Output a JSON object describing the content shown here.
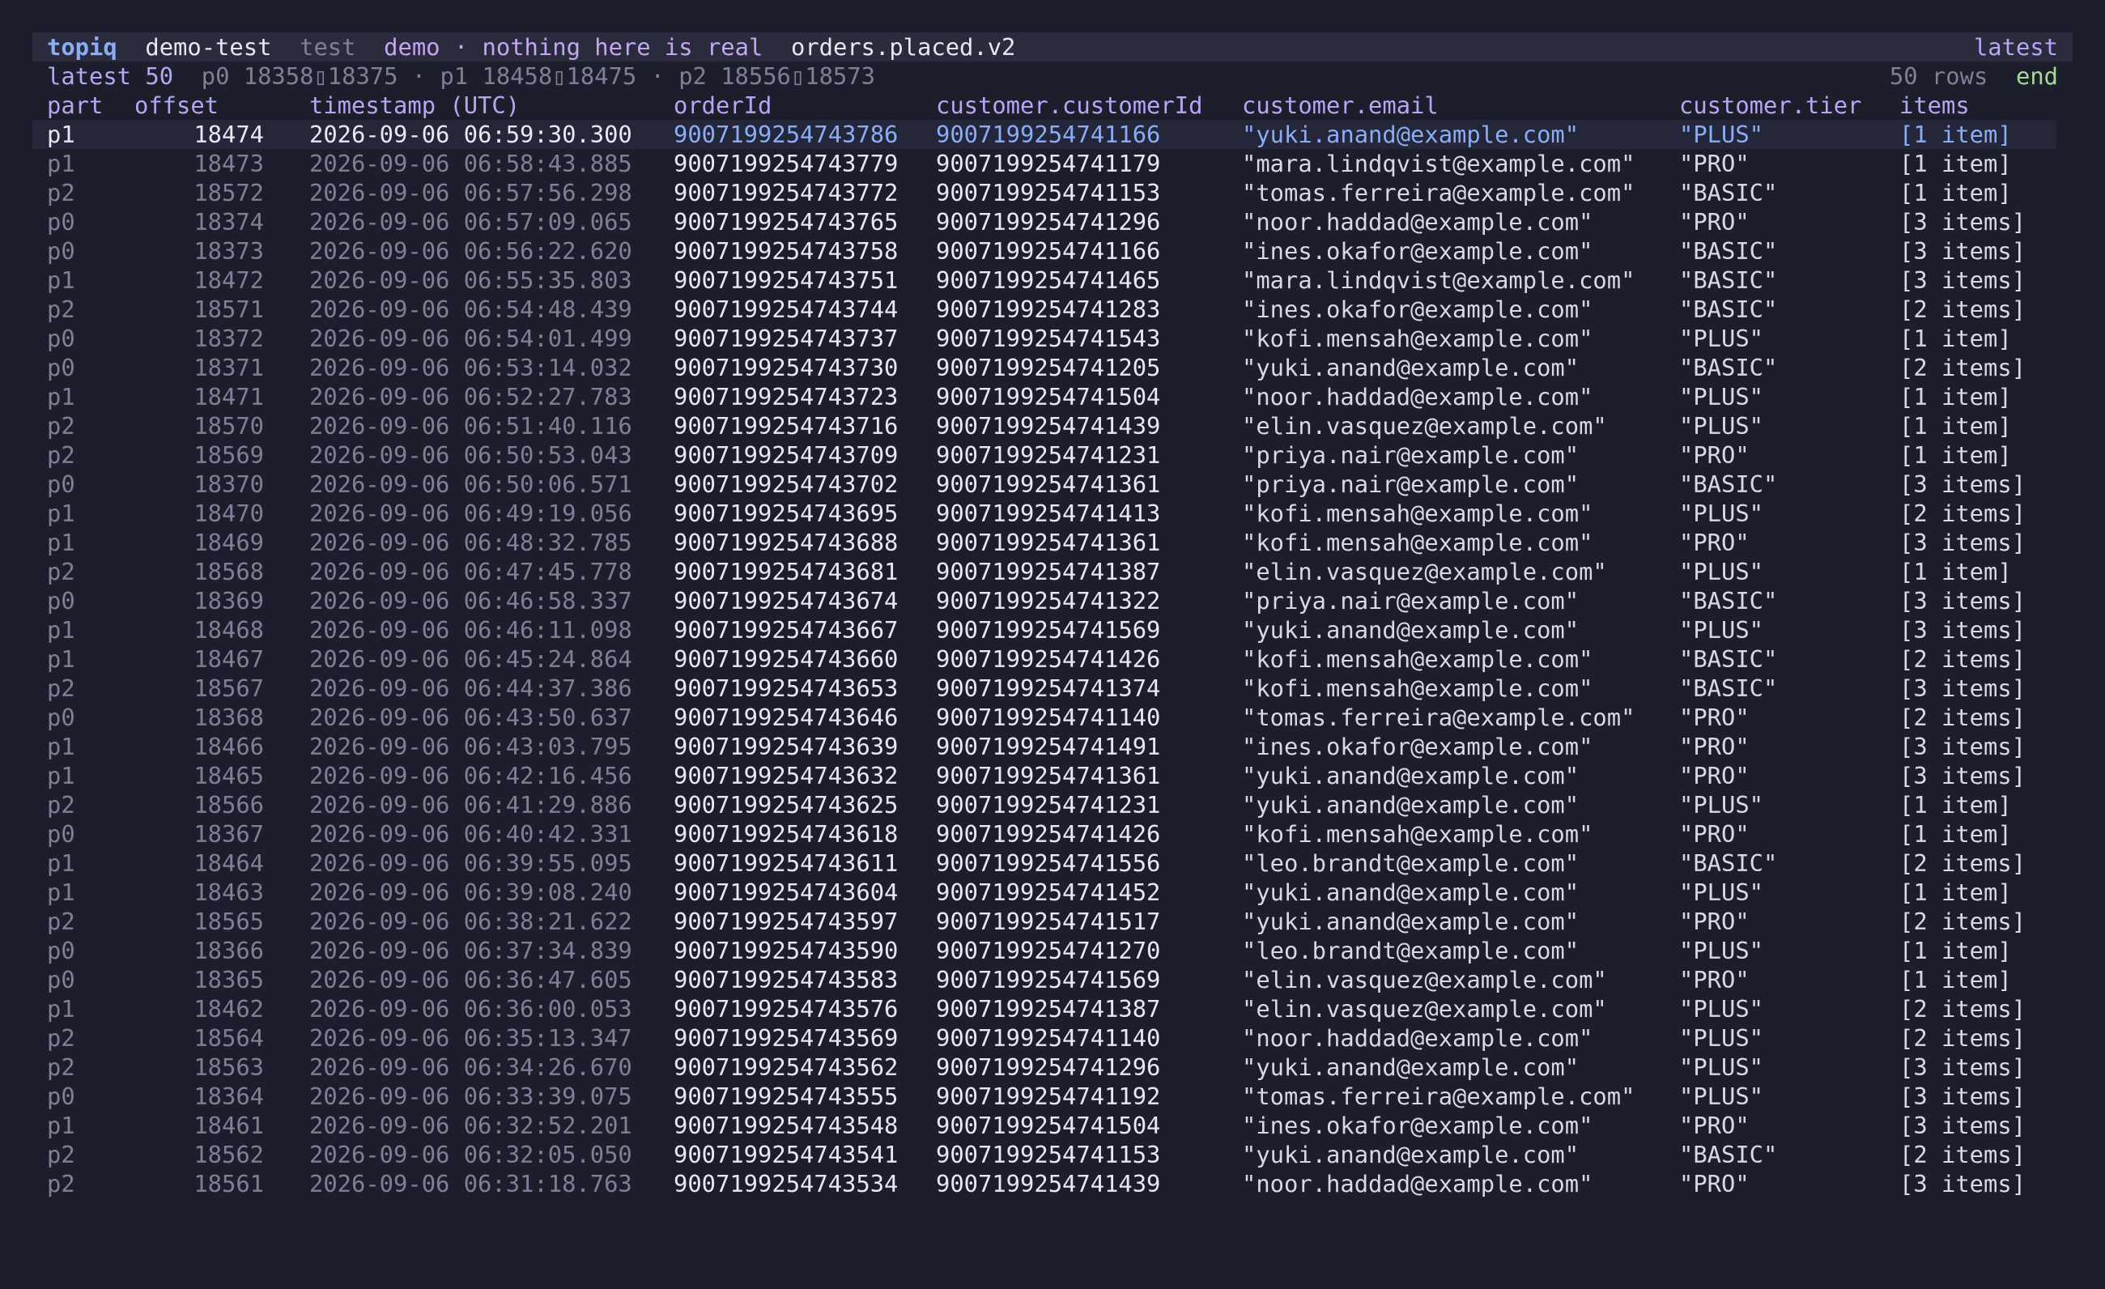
{
  "titlebar": {
    "app": "topiq",
    "profile": "demo-test",
    "env": "test",
    "cluster": "demo",
    "separator": "·",
    "note": "nothing here is real",
    "topic": "orders.placed.v2",
    "mode": "latest"
  },
  "statusbar": {
    "mode": "latest 50",
    "ranges": "p0 18358▯18375 · p1 18458▯18475 · p2 18556▯18573",
    "row_count": "50 rows",
    "position": "end"
  },
  "columns": [
    "part",
    "offset",
    "timestamp (UTC)",
    "orderId",
    "customer.customerId",
    "customer.email",
    "customer.tier",
    "items"
  ],
  "rows": [
    {
      "part": "p1",
      "offset": "18474",
      "ts": "2026-09-06 06:59:30.300",
      "orderId": "9007199254743786",
      "customerId": "9007199254741166",
      "email": "\"yuki.anand@example.com\"",
      "tier": "\"PLUS\"",
      "items": "[1 item]"
    },
    {
      "part": "p1",
      "offset": "18473",
      "ts": "2026-09-06 06:58:43.885",
      "orderId": "9007199254743779",
      "customerId": "9007199254741179",
      "email": "\"mara.lindqvist@example.com\"",
      "tier": "\"PRO\"",
      "items": "[1 item]"
    },
    {
      "part": "p2",
      "offset": "18572",
      "ts": "2026-09-06 06:57:56.298",
      "orderId": "9007199254743772",
      "customerId": "9007199254741153",
      "email": "\"tomas.ferreira@example.com\"",
      "tier": "\"BASIC\"",
      "items": "[1 item]"
    },
    {
      "part": "p0",
      "offset": "18374",
      "ts": "2026-09-06 06:57:09.065",
      "orderId": "9007199254743765",
      "customerId": "9007199254741296",
      "email": "\"noor.haddad@example.com\"",
      "tier": "\"PRO\"",
      "items": "[3 items]"
    },
    {
      "part": "p0",
      "offset": "18373",
      "ts": "2026-09-06 06:56:22.620",
      "orderId": "9007199254743758",
      "customerId": "9007199254741166",
      "email": "\"ines.okafor@example.com\"",
      "tier": "\"BASIC\"",
      "items": "[3 items]"
    },
    {
      "part": "p1",
      "offset": "18472",
      "ts": "2026-09-06 06:55:35.803",
      "orderId": "9007199254743751",
      "customerId": "9007199254741465",
      "email": "\"mara.lindqvist@example.com\"",
      "tier": "\"BASIC\"",
      "items": "[3 items]"
    },
    {
      "part": "p2",
      "offset": "18571",
      "ts": "2026-09-06 06:54:48.439",
      "orderId": "9007199254743744",
      "customerId": "9007199254741283",
      "email": "\"ines.okafor@example.com\"",
      "tier": "\"BASIC\"",
      "items": "[2 items]"
    },
    {
      "part": "p0",
      "offset": "18372",
      "ts": "2026-09-06 06:54:01.499",
      "orderId": "9007199254743737",
      "customerId": "9007199254741543",
      "email": "\"kofi.mensah@example.com\"",
      "tier": "\"PLUS\"",
      "items": "[1 item]"
    },
    {
      "part": "p0",
      "offset": "18371",
      "ts": "2026-09-06 06:53:14.032",
      "orderId": "9007199254743730",
      "customerId": "9007199254741205",
      "email": "\"yuki.anand@example.com\"",
      "tier": "\"BASIC\"",
      "items": "[2 items]"
    },
    {
      "part": "p1",
      "offset": "18471",
      "ts": "2026-09-06 06:52:27.783",
      "orderId": "9007199254743723",
      "customerId": "9007199254741504",
      "email": "\"noor.haddad@example.com\"",
      "tier": "\"PLUS\"",
      "items": "[1 item]"
    },
    {
      "part": "p2",
      "offset": "18570",
      "ts": "2026-09-06 06:51:40.116",
      "orderId": "9007199254743716",
      "customerId": "9007199254741439",
      "email": "\"elin.vasquez@example.com\"",
      "tier": "\"PLUS\"",
      "items": "[1 item]"
    },
    {
      "part": "p2",
      "offset": "18569",
      "ts": "2026-09-06 06:50:53.043",
      "orderId": "9007199254743709",
      "customerId": "9007199254741231",
      "email": "\"priya.nair@example.com\"",
      "tier": "\"PRO\"",
      "items": "[1 item]"
    },
    {
      "part": "p0",
      "offset": "18370",
      "ts": "2026-09-06 06:50:06.571",
      "orderId": "9007199254743702",
      "customerId": "9007199254741361",
      "email": "\"priya.nair@example.com\"",
      "tier": "\"BASIC\"",
      "items": "[3 items]"
    },
    {
      "part": "p1",
      "offset": "18470",
      "ts": "2026-09-06 06:49:19.056",
      "orderId": "9007199254743695",
      "customerId": "9007199254741413",
      "email": "\"kofi.mensah@example.com\"",
      "tier": "\"PLUS\"",
      "items": "[2 items]"
    },
    {
      "part": "p1",
      "offset": "18469",
      "ts": "2026-09-06 06:48:32.785",
      "orderId": "9007199254743688",
      "customerId": "9007199254741361",
      "email": "\"kofi.mensah@example.com\"",
      "tier": "\"PRO\"",
      "items": "[3 items]"
    },
    {
      "part": "p2",
      "offset": "18568",
      "ts": "2026-09-06 06:47:45.778",
      "orderId": "9007199254743681",
      "customerId": "9007199254741387",
      "email": "\"elin.vasquez@example.com\"",
      "tier": "\"PLUS\"",
      "items": "[1 item]"
    },
    {
      "part": "p0",
      "offset": "18369",
      "ts": "2026-09-06 06:46:58.337",
      "orderId": "9007199254743674",
      "customerId": "9007199254741322",
      "email": "\"priya.nair@example.com\"",
      "tier": "\"BASIC\"",
      "items": "[3 items]"
    },
    {
      "part": "p1",
      "offset": "18468",
      "ts": "2026-09-06 06:46:11.098",
      "orderId": "9007199254743667",
      "customerId": "9007199254741569",
      "email": "\"yuki.anand@example.com\"",
      "tier": "\"PLUS\"",
      "items": "[3 items]"
    },
    {
      "part": "p1",
      "offset": "18467",
      "ts": "2026-09-06 06:45:24.864",
      "orderId": "9007199254743660",
      "customerId": "9007199254741426",
      "email": "\"kofi.mensah@example.com\"",
      "tier": "\"BASIC\"",
      "items": "[2 items]"
    },
    {
      "part": "p2",
      "offset": "18567",
      "ts": "2026-09-06 06:44:37.386",
      "orderId": "9007199254743653",
      "customerId": "9007199254741374",
      "email": "\"kofi.mensah@example.com\"",
      "tier": "\"BASIC\"",
      "items": "[3 items]"
    },
    {
      "part": "p0",
      "offset": "18368",
      "ts": "2026-09-06 06:43:50.637",
      "orderId": "9007199254743646",
      "customerId": "9007199254741140",
      "email": "\"tomas.ferreira@example.com\"",
      "tier": "\"PRO\"",
      "items": "[2 items]"
    },
    {
      "part": "p1",
      "offset": "18466",
      "ts": "2026-09-06 06:43:03.795",
      "orderId": "9007199254743639",
      "customerId": "9007199254741491",
      "email": "\"ines.okafor@example.com\"",
      "tier": "\"PRO\"",
      "items": "[3 items]"
    },
    {
      "part": "p1",
      "offset": "18465",
      "ts": "2026-09-06 06:42:16.456",
      "orderId": "9007199254743632",
      "customerId": "9007199254741361",
      "email": "\"yuki.anand@example.com\"",
      "tier": "\"PRO\"",
      "items": "[3 items]"
    },
    {
      "part": "p2",
      "offset": "18566",
      "ts": "2026-09-06 06:41:29.886",
      "orderId": "9007199254743625",
      "customerId": "9007199254741231",
      "email": "\"yuki.anand@example.com\"",
      "tier": "\"PLUS\"",
      "items": "[1 item]"
    },
    {
      "part": "p0",
      "offset": "18367",
      "ts": "2026-09-06 06:40:42.331",
      "orderId": "9007199254743618",
      "customerId": "9007199254741426",
      "email": "\"kofi.mensah@example.com\"",
      "tier": "\"PRO\"",
      "items": "[1 item]"
    },
    {
      "part": "p1",
      "offset": "18464",
      "ts": "2026-09-06 06:39:55.095",
      "orderId": "9007199254743611",
      "customerId": "9007199254741556",
      "email": "\"leo.brandt@example.com\"",
      "tier": "\"BASIC\"",
      "items": "[2 items]"
    },
    {
      "part": "p1",
      "offset": "18463",
      "ts": "2026-09-06 06:39:08.240",
      "orderId": "9007199254743604",
      "customerId": "9007199254741452",
      "email": "\"yuki.anand@example.com\"",
      "tier": "\"PLUS\"",
      "items": "[1 item]"
    },
    {
      "part": "p2",
      "offset": "18565",
      "ts": "2026-09-06 06:38:21.622",
      "orderId": "9007199254743597",
      "customerId": "9007199254741517",
      "email": "\"yuki.anand@example.com\"",
      "tier": "\"PRO\"",
      "items": "[2 items]"
    },
    {
      "part": "p0",
      "offset": "18366",
      "ts": "2026-09-06 06:37:34.839",
      "orderId": "9007199254743590",
      "customerId": "9007199254741270",
      "email": "\"leo.brandt@example.com\"",
      "tier": "\"PLUS\"",
      "items": "[1 item]"
    },
    {
      "part": "p0",
      "offset": "18365",
      "ts": "2026-09-06 06:36:47.605",
      "orderId": "9007199254743583",
      "customerId": "9007199254741569",
      "email": "\"elin.vasquez@example.com\"",
      "tier": "\"PRO\"",
      "items": "[1 item]"
    },
    {
      "part": "p1",
      "offset": "18462",
      "ts": "2026-09-06 06:36:00.053",
      "orderId": "9007199254743576",
      "customerId": "9007199254741387",
      "email": "\"elin.vasquez@example.com\"",
      "tier": "\"PLUS\"",
      "items": "[2 items]"
    },
    {
      "part": "p2",
      "offset": "18564",
      "ts": "2026-09-06 06:35:13.347",
      "orderId": "9007199254743569",
      "customerId": "9007199254741140",
      "email": "\"noor.haddad@example.com\"",
      "tier": "\"PLUS\"",
      "items": "[2 items]"
    },
    {
      "part": "p2",
      "offset": "18563",
      "ts": "2026-09-06 06:34:26.670",
      "orderId": "9007199254743562",
      "customerId": "9007199254741296",
      "email": "\"yuki.anand@example.com\"",
      "tier": "\"PLUS\"",
      "items": "[3 items]"
    },
    {
      "part": "p0",
      "offset": "18364",
      "ts": "2026-09-06 06:33:39.075",
      "orderId": "9007199254743555",
      "customerId": "9007199254741192",
      "email": "\"tomas.ferreira@example.com\"",
      "tier": "\"PLUS\"",
      "items": "[3 items]"
    },
    {
      "part": "p1",
      "offset": "18461",
      "ts": "2026-09-06 06:32:52.201",
      "orderId": "9007199254743548",
      "customerId": "9007199254741504",
      "email": "\"ines.okafor@example.com\"",
      "tier": "\"PRO\"",
      "items": "[3 items]"
    },
    {
      "part": "p2",
      "offset": "18562",
      "ts": "2026-09-06 06:32:05.050",
      "orderId": "9007199254743541",
      "customerId": "9007199254741153",
      "email": "\"yuki.anand@example.com\"",
      "tier": "\"BASIC\"",
      "items": "[2 items]"
    },
    {
      "part": "p2",
      "offset": "18561",
      "ts": "2026-09-06 06:31:18.763",
      "orderId": "9007199254743534",
      "customerId": "9007199254741439",
      "email": "\"noor.haddad@example.com\"",
      "tier": "\"PRO\"",
      "items": "[3 items]"
    }
  ]
}
